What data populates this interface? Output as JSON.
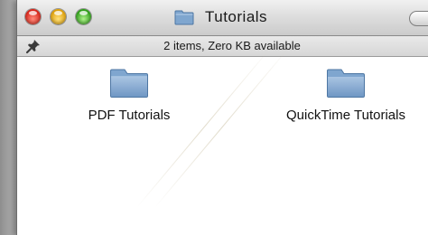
{
  "window": {
    "title": "Tutorials",
    "status": "2 items, Zero KB available"
  },
  "items": [
    {
      "label": "PDF Tutorials",
      "icon": "folder-icon"
    },
    {
      "label": "QuickTime Tutorials",
      "icon": "folder-icon"
    }
  ],
  "colors": {
    "folder_blue": "#7fa6cf",
    "close_red": "#d8251a",
    "minimize_yellow": "#e0a10a",
    "zoom_green": "#2f9f1a"
  }
}
